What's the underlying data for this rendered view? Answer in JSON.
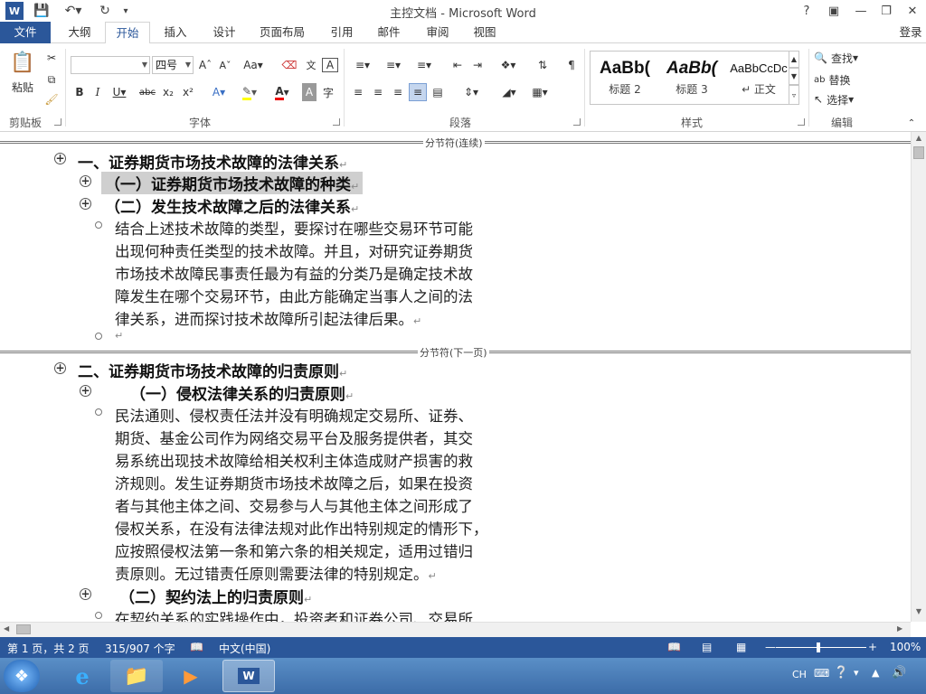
{
  "window": {
    "title": "主控文档 - Microsoft Word",
    "help": "?",
    "login": "登录"
  },
  "tabs": [
    {
      "label": "文件"
    },
    {
      "label": "大纲"
    },
    {
      "label": "开始"
    },
    {
      "label": "插入"
    },
    {
      "label": "设计"
    },
    {
      "label": "页面布局"
    },
    {
      "label": "引用"
    },
    {
      "label": "邮件"
    },
    {
      "label": "审阅"
    },
    {
      "label": "视图"
    }
  ],
  "ribbon": {
    "clipboard": {
      "paste": "粘贴",
      "label": "剪贴板"
    },
    "font": {
      "name": "",
      "size": "四号",
      "label": "字体",
      "case": "Aa"
    },
    "paragraph": {
      "label": "段落"
    },
    "styles": {
      "label": "样式",
      "items": [
        {
          "sample": "AaBb(",
          "name": "标题 2"
        },
        {
          "sample": "AaBb(",
          "name": "标题 3"
        },
        {
          "sample": "AaBbCcDc",
          "name": "↵ 正文"
        }
      ]
    },
    "editing": {
      "label": "编辑",
      "find": "查找",
      "replace": "替换",
      "select": "选择"
    }
  },
  "document": {
    "break_continuous": "分节符(连续)",
    "break_next_page": "分节符(下一页)",
    "h1_a": "一、证券期货市场技术故障的法律关系",
    "h2_a1": "（一）证券期货市场技术故障的种类",
    "h2_a2": "（二）发生技术故障之后的法律关系",
    "para_a": [
      "结合上述技术故障的类型，要探讨在哪些交易环节可能",
      "出现何种责任类型的技术故障。并且，对研究证券期货",
      "市场技术故障民事责任最为有益的分类乃是确定技术故",
      "障发生在哪个交易环节，由此方能确定当事人之间的法",
      "律关系，进而探讨技术故障所引起法律后果。"
    ],
    "h1_b": "二、证券期货市场技术故障的归责原则",
    "h2_b1": "（一）侵权法律关系的归责原则",
    "para_b": [
      "民法通则、侵权责任法并没有明确规定交易所、证券、",
      "期货、基金公司作为网络交易平台及服务提供者，其交",
      "易系统出现技术故障给相关权利主体造成财产损害的救",
      "济规则。发生证券期货市场技术故障之后，如果在投资",
      "者与其他主体之间、交易参与人与其他主体之间形成了",
      "侵权关系，在没有法律法规对此作出特别规定的情形下，",
      "应按照侵权法第一条和第六条的相关规定，适用过错归",
      "责原则。无过错责任原则需要法律的特别规定。"
    ],
    "h2_b2": "（二）契约法上的归责原则",
    "para_c": "在契约关系的实践操作中，投资者和证券公司、交易所",
    "para_mark": "↵"
  },
  "status": {
    "page": "第 1 页，共 2 页",
    "words": "315/907 个字",
    "lang": "中文(中国)",
    "zoom": "100%"
  },
  "tray": {
    "input": "CH"
  }
}
